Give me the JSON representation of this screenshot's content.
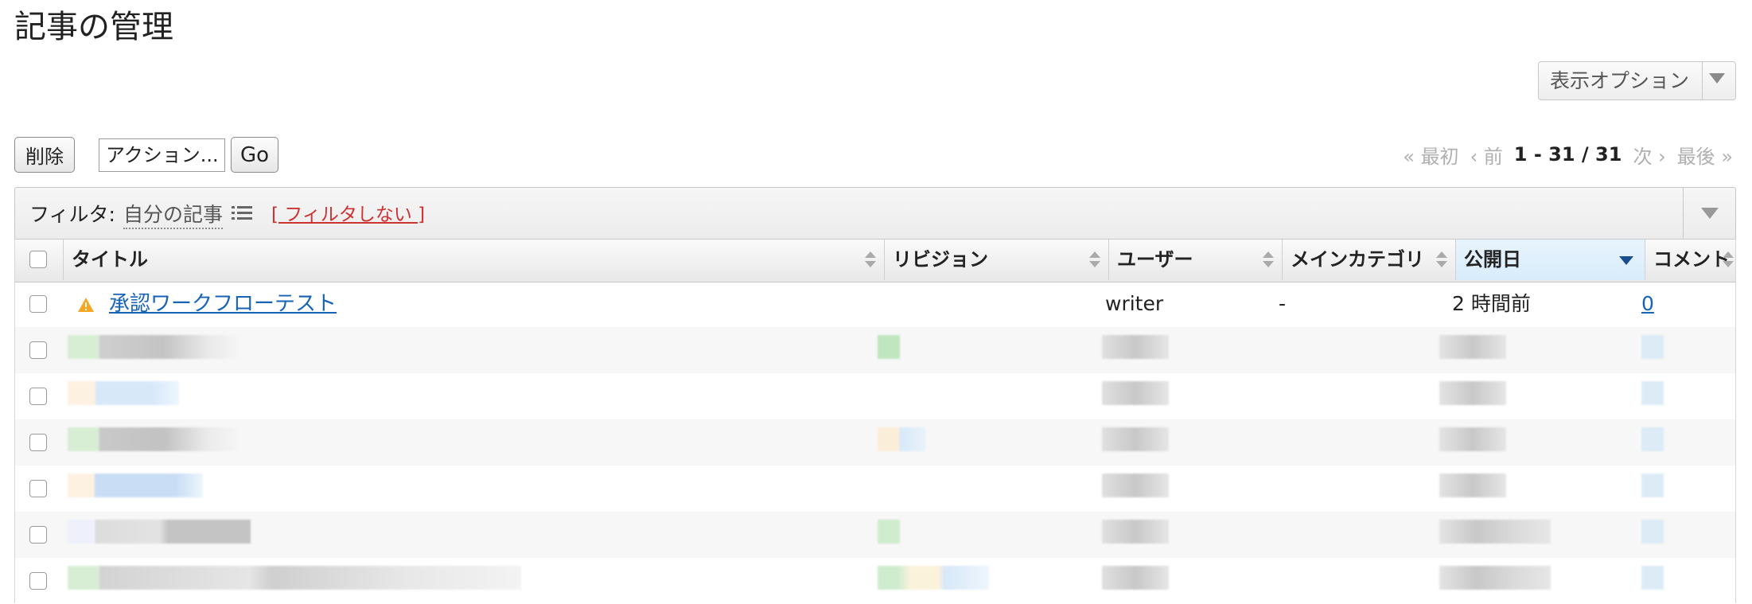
{
  "page": {
    "title": "記事の管理"
  },
  "toolbar": {
    "display_options_label": "表示オプション",
    "delete_label": "削除",
    "action_label": "アクション...",
    "go_label": "Go"
  },
  "pager": {
    "first": "« 最初",
    "prev": "‹ 前",
    "range": "1 - 31 / 31",
    "next": "次 ›",
    "last": "最後 »"
  },
  "filter": {
    "label": "フィルタ:",
    "value": "自分の記事",
    "clear_label": "[ フィルタしない ]"
  },
  "table": {
    "columns": [
      {
        "key": "title",
        "label": "タイトル"
      },
      {
        "key": "revision",
        "label": "リビジョン"
      },
      {
        "key": "user",
        "label": "ユーザー"
      },
      {
        "key": "category",
        "label": "メインカテゴリ"
      },
      {
        "key": "published",
        "label": "公開日"
      },
      {
        "key": "comments",
        "label": "コメント"
      }
    ],
    "sorted_column": "published",
    "rows": [
      {
        "title": "承認ワークフローテスト",
        "revision": "",
        "user": "writer",
        "category": "-",
        "published": "2 時間前",
        "comments": "0",
        "warning": true
      }
    ]
  },
  "colors": {
    "link": "#1763b5",
    "filter_clear": "#cc3333",
    "warning": "#f5a623",
    "active_header": "#dcedfb"
  }
}
